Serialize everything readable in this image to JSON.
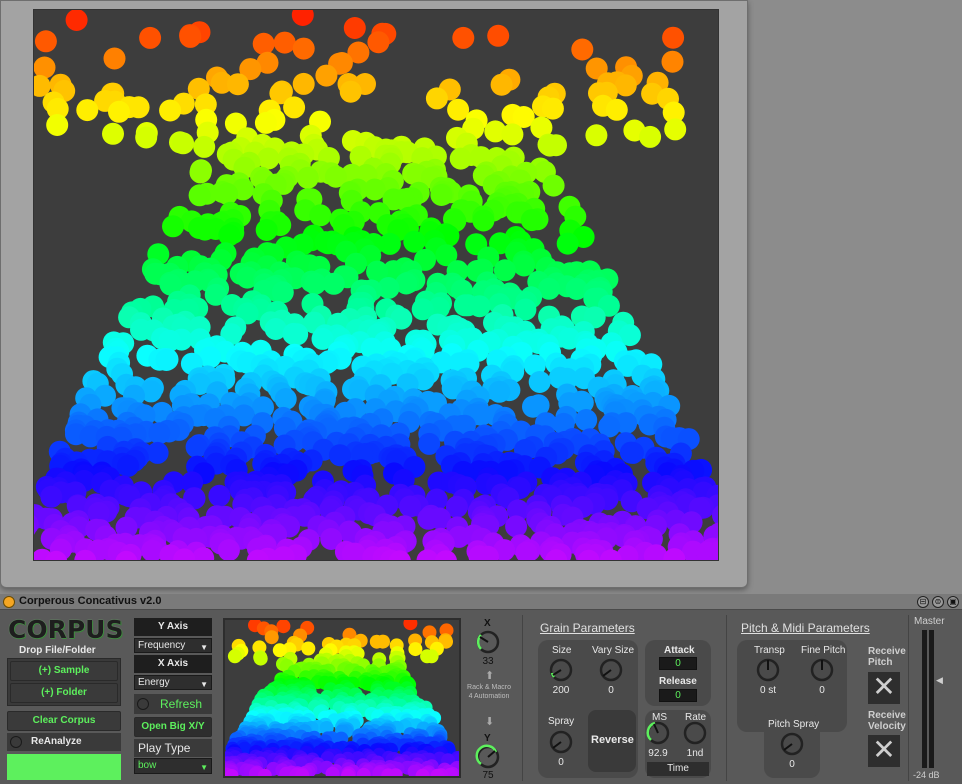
{
  "window": {
    "title": "Corperous Concativus v2.0"
  },
  "logo": {
    "text": "CORPUS"
  },
  "left": {
    "drop_label": "Drop File/Folder",
    "add_sample": "(+) Sample",
    "add_folder": "(+) Folder",
    "clear_corpus": "Clear Corpus",
    "reanalyze": "ReAnalyze"
  },
  "axes": {
    "y_axis_label": "Y Axis",
    "y_axis_value": "Frequency",
    "x_axis_label": "X Axis",
    "x_axis_value": "Energy",
    "refresh": "Refresh",
    "open_big": "Open Big X/Y",
    "play_type_label": "Play Type",
    "play_type_value": "bow"
  },
  "xy": {
    "x_label": "X",
    "x_value": "33",
    "automation_label": "Rack & Macro 4 Automation",
    "y_label": "Y",
    "y_value": "75"
  },
  "grain": {
    "title": "Grain Parameters",
    "size_label": "Size",
    "size_value": "200",
    "vary_size_label": "Vary Size",
    "vary_size_value": "0",
    "spray_label": "Spray",
    "spray_value": "0",
    "reverse": "Reverse",
    "attack_label": "Attack",
    "attack_value": "0",
    "release_label": "Release",
    "release_value": "0",
    "ms_label": "MS",
    "ms_value": "92.9",
    "rate_label": "Rate",
    "rate_value": "1nd",
    "time_label": "Time"
  },
  "pitch": {
    "title": "Pitch & Midi Parameters",
    "transp_label": "Transp",
    "transp_value": "0 st",
    "fine_label": "Fine Pitch",
    "fine_value": "0",
    "spray_label": "Pitch Spray",
    "spray_value": "0",
    "receive_pitch": "Receive Pitch",
    "receive_velocity": "Receive Velocity"
  },
  "master": {
    "label": "Master",
    "db": "-24 dB"
  },
  "colors": {
    "accent_green": "#5df05d",
    "power_orange": "#f5a623"
  }
}
